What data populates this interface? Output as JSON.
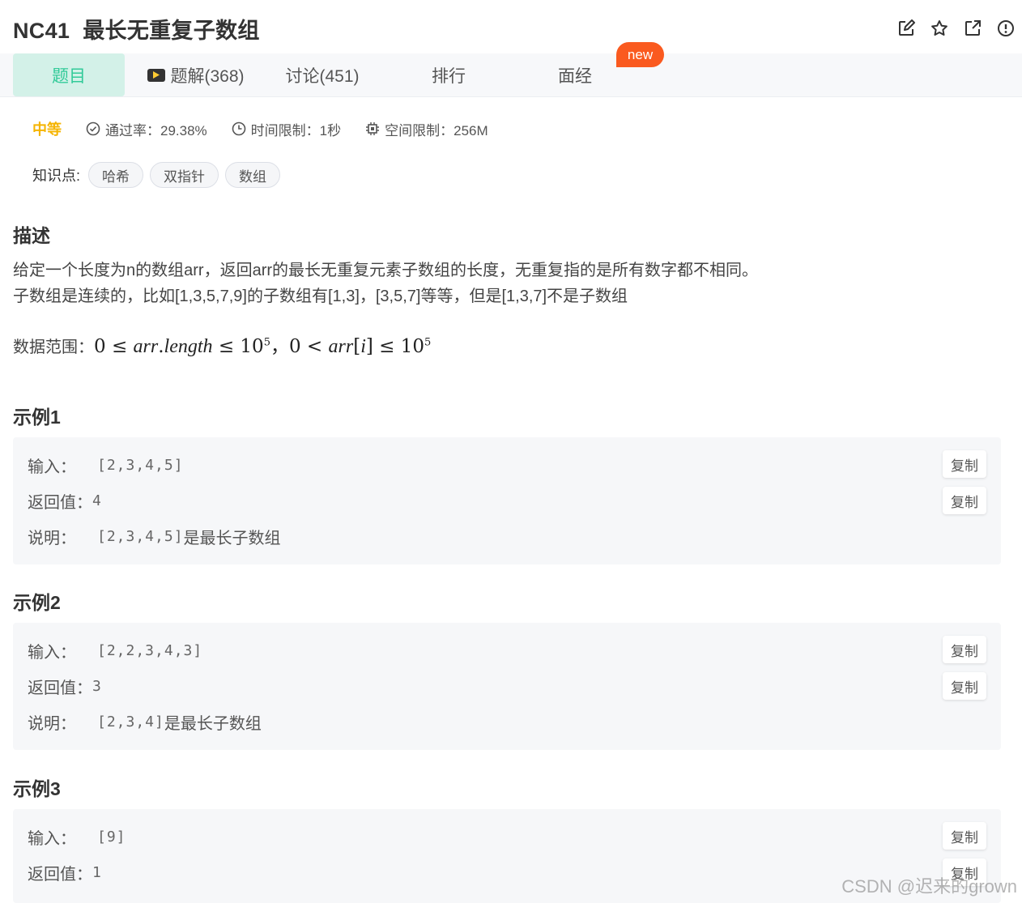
{
  "problem": {
    "code": "NC41",
    "name": "最长无重复子数组"
  },
  "tabs": {
    "question": "题目",
    "solutions": "题解(368)",
    "discuss": "讨论(451)",
    "rank": "排行",
    "interview": "面经",
    "new_badge": "new"
  },
  "meta": {
    "difficulty": "中等",
    "pass_rate": "通过率：29.38%",
    "time_limit": "时间限制：1秒",
    "memory_limit": "空间限制：256M"
  },
  "knowledge": {
    "label": "知识点:",
    "tags": [
      "哈希",
      "双指针",
      "数组"
    ]
  },
  "description": {
    "heading": "描述",
    "line1": "给定一个长度为n的数组arr，返回arr的最长无重复元素子数组的长度，无重复指的是所有数字都不相同。",
    "line2": "子数组是连续的，比如[1,3,5,7,9]的子数组有[1,3]，[3,5,7]等等，但是[1,3,7]不是子数组",
    "range_label": "数据范围："
  },
  "labels": {
    "input": "输入：",
    "output": "返回值：",
    "explain": "说明：",
    "copy": "复制"
  },
  "examples": [
    {
      "heading": "示例1",
      "input": "[2,3,4,5]",
      "output": "4",
      "explain_code": "[2,3,4,5]",
      "explain_text": "是最长子数组"
    },
    {
      "heading": "示例2",
      "input": "[2,2,3,4,3]",
      "output": "3",
      "explain_code": "[2,3,4]",
      "explain_text": "是最长子数组"
    },
    {
      "heading": "示例3",
      "input": "[9]",
      "output": "1"
    }
  ],
  "watermark": "CSDN @迟来的grown",
  "colors": {
    "accent": "#32ca99",
    "difficulty": "#f5b400",
    "new_badge": "#fa5a1f"
  }
}
